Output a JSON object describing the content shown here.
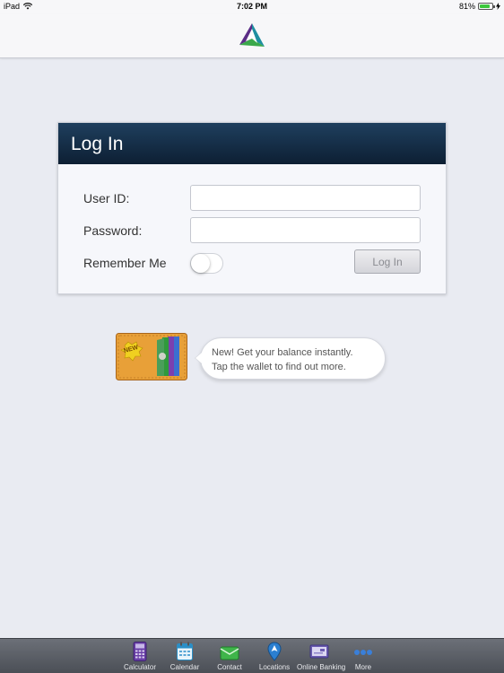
{
  "status_bar": {
    "device": "iPad",
    "time": "7:02 PM",
    "battery": "81%",
    "battery_level": 0.81
  },
  "login": {
    "title": "Log In",
    "user_id_label": "User ID:",
    "user_id_value": "",
    "password_label": "Password:",
    "password_value": "",
    "remember_label": "Remember Me",
    "remember_on": false,
    "button_label": "Log In"
  },
  "promo": {
    "badge": "NEW",
    "line1": "New! Get your balance instantly.",
    "line2": "Tap the wallet to find out more."
  },
  "tabs": [
    {
      "label": "Calculator",
      "icon": "calculator-icon"
    },
    {
      "label": "Calendar",
      "icon": "calendar-icon"
    },
    {
      "label": "Contact",
      "icon": "envelope-icon"
    },
    {
      "label": "Locations",
      "icon": "location-pin-icon"
    },
    {
      "label": "Online Banking",
      "icon": "online-banking-icon"
    },
    {
      "label": "More",
      "icon": "more-dots-icon"
    }
  ],
  "colors": {
    "header": "#0d1f33",
    "background": "#e9ebf2",
    "tab_bar": "#4b4f56",
    "logo_green": "#3aa84a",
    "logo_purple": "#5b2d86",
    "logo_teal": "#1e8fa0"
  }
}
